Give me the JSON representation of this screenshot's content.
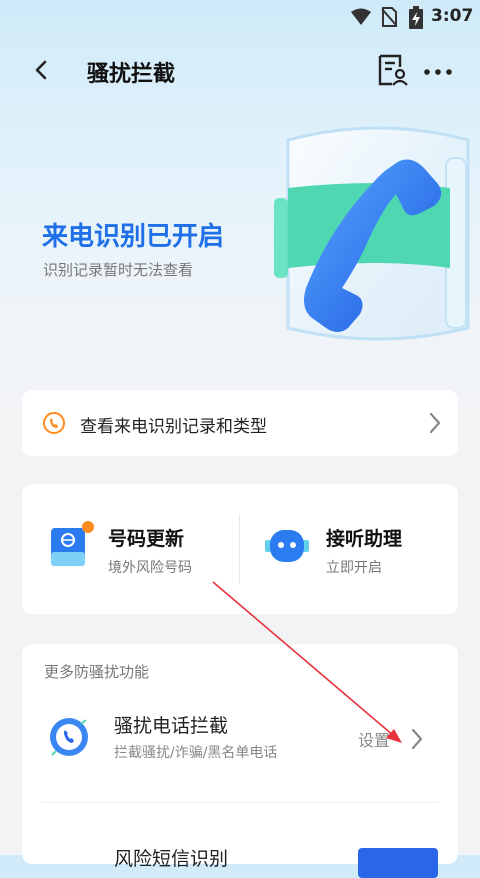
{
  "status_bar": {
    "time": "3:07"
  },
  "header": {
    "title": "骚扰拦截"
  },
  "hero": {
    "title": "来电识别已开启",
    "subtitle": "识别记录暂时无法查看"
  },
  "record_entry": {
    "label": "查看来电识别记录和类型"
  },
  "features": [
    {
      "title": "号码更新",
      "desc": "境外风险号码"
    },
    {
      "title": "接听助理",
      "desc": "立即开启"
    }
  ],
  "more_section": {
    "title": "更多防骚扰功能",
    "items": [
      {
        "title": "骚扰电话拦截",
        "desc": "拦截骚扰/诈骗/黑名单电话",
        "action": "设置"
      },
      {
        "title": "风险短信识别"
      }
    ]
  },
  "colors": {
    "accent": "#1f6fe8",
    "badge": "#ff8a1f",
    "annotation_arrow": "#e8323c"
  }
}
